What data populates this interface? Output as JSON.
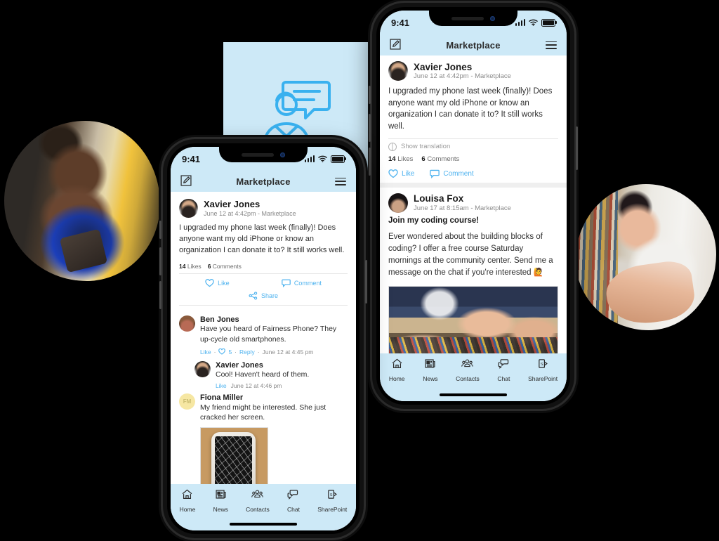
{
  "scene": {
    "background_color": "#000000",
    "accent_blue": "#4fb3ef",
    "panel_blue": "#cde9f7",
    "illustration_icon": "person-with-speech-bubble-icon"
  },
  "people_photos": [
    {
      "name": "photo-woman-with-phone",
      "alt": "Woman in blue top looking at her smartphone on a city street"
    },
    {
      "name": "photo-two-colleagues",
      "alt": "Two people working together in front of a bookshelf"
    }
  ],
  "phone_back": {
    "status_bar": {
      "time": "9:41",
      "signal": "signal-icon",
      "wifi": "wifi-icon",
      "battery": "battery-icon"
    },
    "app_bar": {
      "compose": "compose-icon",
      "title": "Marketplace",
      "menu": "hamburger-menu-icon"
    },
    "posts": [
      {
        "author": "Xavier Jones",
        "meta": "June 12 at 4:42pm - Marketplace",
        "avatar": "avatar-xavier-jones",
        "body": "I upgraded my phone last week (finally)! Does anyone want my old iPhone or know an organization I can donate it to? It still works well.",
        "translation_label": "Show translation",
        "likes_count": "14",
        "likes_label": "Likes",
        "comments_count": "6",
        "comments_label": "Comments",
        "actions": [
          {
            "label": "Like",
            "icon": "heart-icon"
          },
          {
            "label": "Comment",
            "icon": "speech-bubble-icon"
          }
        ]
      },
      {
        "author": "Louisa Fox",
        "meta": "June 17 at 8:15am - Marketplace",
        "avatar": "avatar-louisa-fox",
        "headline": "Join my coding course!",
        "body": "Ever wondered about the building blocks of coding? I offer a free course Saturday mornings at the community center. Send me a message on the chat if you're interested 🙋",
        "image": "photo-coding-workshop-hands"
      }
    ],
    "tab_bar": [
      {
        "label": "Home",
        "icon": "home-icon"
      },
      {
        "label": "News",
        "icon": "news-icon"
      },
      {
        "label": "Contacts",
        "icon": "contacts-icon"
      },
      {
        "label": "Chat",
        "icon": "chat-icon"
      },
      {
        "label": "SharePoint",
        "icon": "sharepoint-icon"
      }
    ]
  },
  "phone_front": {
    "status_bar": {
      "time": "9:41",
      "signal": "signal-icon",
      "wifi": "wifi-icon",
      "battery": "battery-icon"
    },
    "app_bar": {
      "compose": "compose-icon",
      "title": "Marketplace",
      "menu": "hamburger-menu-icon"
    },
    "post": {
      "author": "Xavier Jones",
      "meta": "June 12 at 4:42pm - Marketplace",
      "avatar": "avatar-xavier-jones",
      "body": "I upgraded my phone last week (finally)! Does anyone want my old iPhone or know an organization I can donate it to? It still works well.",
      "likes_count": "14",
      "likes_label": "Likes",
      "comments_count": "6",
      "comments_label": "Comments",
      "actions": [
        {
          "label": "Like",
          "icon": "heart-icon"
        },
        {
          "label": "Comment",
          "icon": "speech-bubble-icon"
        },
        {
          "label": "Share",
          "icon": "share-icon"
        }
      ]
    },
    "comments": [
      {
        "author": "Ben Jones",
        "avatar": "avatar-ben-jones",
        "text": "Have you heard of Fairness Phone? They up-cycle old smartphones.",
        "like_label": "Like",
        "like_icon": "heart-icon",
        "like_count": "5",
        "reply_label": "Reply",
        "timestamp": "June 12 at 4:45 pm"
      },
      {
        "author": "Xavier Jones",
        "avatar": "avatar-xavier-jones",
        "text": "Cool! Haven't heard of them.",
        "like_label": "Like",
        "timestamp": "June 12 at 4:46 pm",
        "indented": true
      },
      {
        "author": "Fiona Miller",
        "avatar_initials": "FM",
        "text": "My friend might be interested. She just cracked her screen.",
        "image": "photo-cracked-iphone"
      }
    ],
    "tab_bar": [
      {
        "label": "Home",
        "icon": "home-icon"
      },
      {
        "label": "News",
        "icon": "news-icon"
      },
      {
        "label": "Contacts",
        "icon": "contacts-icon"
      },
      {
        "label": "Chat",
        "icon": "chat-icon"
      },
      {
        "label": "SharePoint",
        "icon": "sharepoint-icon"
      }
    ]
  }
}
